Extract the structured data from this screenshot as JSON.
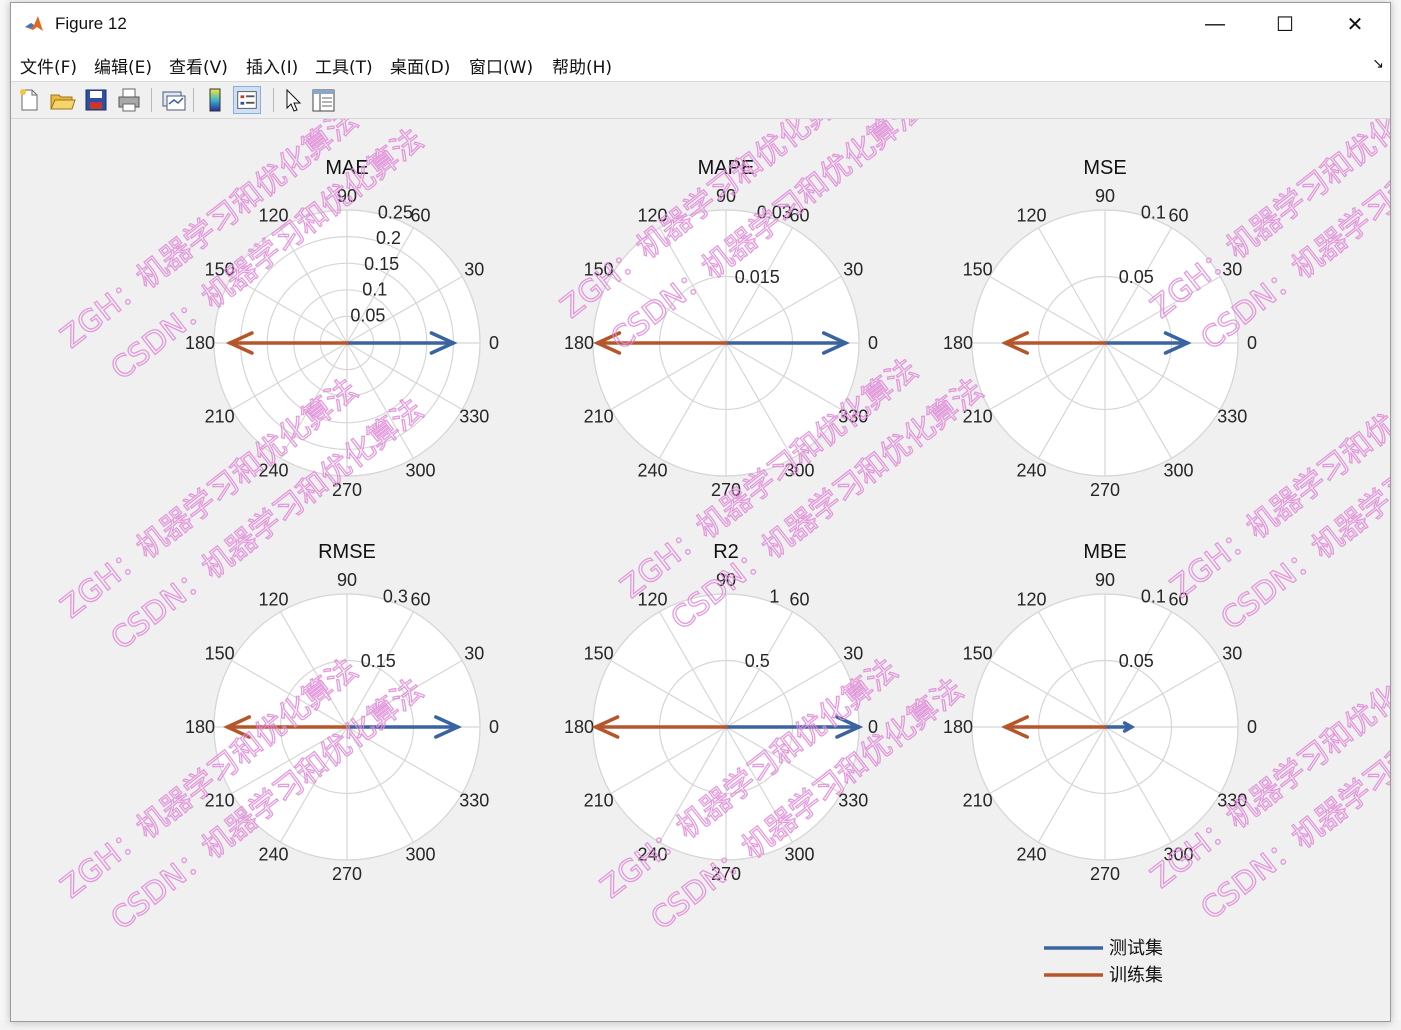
{
  "window": {
    "title": "Figure 12",
    "minimize_glyph": "—",
    "maximize_glyph": "☐",
    "close_glyph": "✕"
  },
  "menu": {
    "items": [
      "文件(F)",
      "编辑(E)",
      "查看(V)",
      "插入(I)",
      "工具(T)",
      "桌面(D)",
      "窗口(W)",
      "帮助(H)"
    ],
    "overflow_glyph": "↘"
  },
  "toolbar": {
    "icons": [
      "new-figure-icon",
      "open-file-icon",
      "save-icon",
      "print-icon",
      "link-plot-icon",
      "colorbar-icon",
      "legend-icon",
      "edit-pointer-icon",
      "property-inspector-icon"
    ]
  },
  "chart_data": [
    {
      "type": "polar-compass",
      "title": "MAE",
      "angle_ticks": [
        "0",
        "30",
        "60",
        "90",
        "120",
        "150",
        "180",
        "210",
        "240",
        "270",
        "300",
        "330"
      ],
      "r_ticks": [
        "0.05",
        "0.1",
        "0.15",
        "0.2",
        "0.25"
      ],
      "r_max": 0.25,
      "series": [
        {
          "name": "测试集",
          "angle": 0,
          "value": 0.2
        },
        {
          "name": "训练集",
          "angle": 180,
          "value": 0.22
        }
      ]
    },
    {
      "type": "polar-compass",
      "title": "MAPE",
      "angle_ticks": [
        "0",
        "30",
        "60",
        "90",
        "120",
        "150",
        "180",
        "210",
        "240",
        "270",
        "300",
        "330"
      ],
      "r_ticks": [
        "0.015",
        "0.03"
      ],
      "r_max": 0.03,
      "series": [
        {
          "name": "测试集",
          "angle": 0,
          "value": 0.027
        },
        {
          "name": "训练集",
          "angle": 180,
          "value": 0.029
        }
      ]
    },
    {
      "type": "polar-compass",
      "title": "MSE",
      "angle_ticks": [
        "0",
        "30",
        "60",
        "90",
        "120",
        "150",
        "180",
        "210",
        "240",
        "270",
        "300",
        "330"
      ],
      "r_ticks": [
        "0.05",
        "0.1"
      ],
      "r_max": 0.1,
      "series": [
        {
          "name": "测试集",
          "angle": 0,
          "value": 0.062
        },
        {
          "name": "训练集",
          "angle": 180,
          "value": 0.075
        }
      ]
    },
    {
      "type": "polar-compass",
      "title": "RMSE",
      "angle_ticks": [
        "0",
        "30",
        "60",
        "90",
        "120",
        "150",
        "180",
        "210",
        "240",
        "270",
        "300",
        "330"
      ],
      "r_ticks": [
        "0.15",
        "0.3"
      ],
      "r_max": 0.3,
      "series": [
        {
          "name": "测试集",
          "angle": 0,
          "value": 0.25
        },
        {
          "name": "训练集",
          "angle": 180,
          "value": 0.27
        }
      ]
    },
    {
      "type": "polar-compass",
      "title": "R2",
      "angle_ticks": [
        "0",
        "30",
        "60",
        "90",
        "120",
        "150",
        "180",
        "210",
        "240",
        "270",
        "300",
        "330"
      ],
      "r_ticks": [
        "0.5",
        "1"
      ],
      "r_max": 1,
      "series": [
        {
          "name": "测试集",
          "angle": 0,
          "value": 1.0
        },
        {
          "name": "训练集",
          "angle": 180,
          "value": 0.98
        }
      ]
    },
    {
      "type": "polar-compass",
      "title": "MBE",
      "angle_ticks": [
        "0",
        "30",
        "60",
        "90",
        "120",
        "150",
        "180",
        "210",
        "240",
        "270",
        "300",
        "330"
      ],
      "r_ticks": [
        "0.05",
        "0.1"
      ],
      "r_max": 0.1,
      "series": [
        {
          "name": "测试集",
          "angle": 0,
          "value": 0.02
        },
        {
          "name": "训练集",
          "angle": 180,
          "value": 0.075
        }
      ]
    }
  ],
  "legend": {
    "entries": [
      {
        "label": "测试集",
        "color": "#3a64a0"
      },
      {
        "label": "训练集",
        "color": "#b5562a"
      }
    ]
  },
  "colors": {
    "test": "#3a64a0",
    "train": "#b5562a",
    "grid": "#d6d6d6",
    "axes_bg": "#ffffff",
    "watermark": "#e08ad8"
  },
  "watermark": {
    "lines": [
      "ZGH：机器学习和优化算法",
      "CSDN：机器学习和优化算法"
    ]
  }
}
